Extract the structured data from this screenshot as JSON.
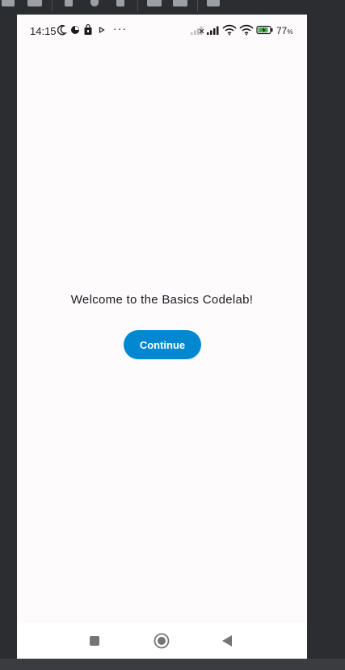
{
  "status_bar": {
    "time": "14:15",
    "notification_icons": [
      "moon-icon",
      "pinwheel-icon",
      "shopping-bag-icon",
      "play-icon",
      "more-icon"
    ],
    "more_glyph": "···",
    "system_icons": [
      "no-signal-icon",
      "signal-icon",
      "wifi-icon",
      "wifi-icon",
      "battery-charging-icon"
    ],
    "battery_percent": "77",
    "battery_suffix": "%"
  },
  "content": {
    "welcome_text": "Welcome to the Basics Codelab!",
    "continue_label": "Continue"
  },
  "nav_bar": {
    "buttons": [
      "recents-icon",
      "home-icon",
      "back-icon"
    ]
  },
  "colors": {
    "accent": "#0288d1",
    "screen_background": "#fdfbfc",
    "text": "#1c1b1f",
    "emulator_chrome": "#2b2d30"
  }
}
